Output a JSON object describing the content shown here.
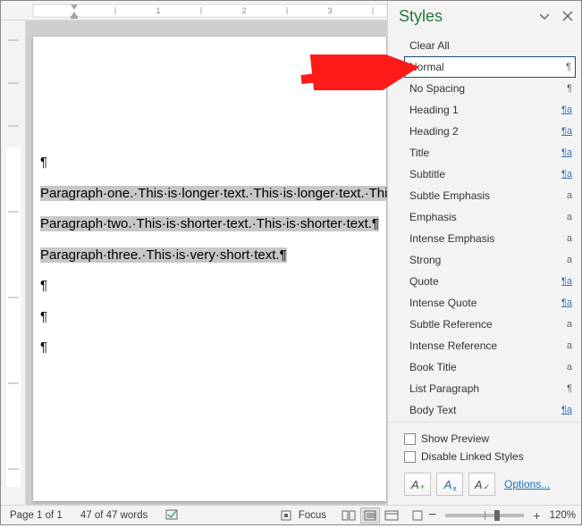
{
  "ruler": {
    "h_marks": [
      "1",
      "2",
      "3"
    ]
  },
  "document": {
    "blank_para_marker": "¶",
    "paragraphs": [
      "Paragraph·one.·This·is·longer·text.·This·is·longer·text.·This·is·longer·text.¶",
      "Paragraph·two.·This·is·shorter·text.·This·is·shorter·text.¶",
      "Paragraph·three.·This·is·very·short·text.¶"
    ]
  },
  "styles_pane": {
    "title": "Styles",
    "items": [
      {
        "label": "Clear All",
        "glyph": "",
        "glyph_style": "",
        "selected": false
      },
      {
        "label": "Normal",
        "glyph": "¶",
        "glyph_style": "",
        "selected": true
      },
      {
        "label": "No Spacing",
        "glyph": "¶",
        "glyph_style": "",
        "selected": false
      },
      {
        "label": "Heading 1",
        "glyph": "¶a",
        "glyph_style": "underline",
        "selected": false
      },
      {
        "label": "Heading 2",
        "glyph": "¶a",
        "glyph_style": "underline",
        "selected": false
      },
      {
        "label": "Title",
        "glyph": "¶a",
        "glyph_style": "underline",
        "selected": false
      },
      {
        "label": "Subtitle",
        "glyph": "¶a",
        "glyph_style": "underline",
        "selected": false
      },
      {
        "label": "Subtle Emphasis",
        "glyph": "a",
        "glyph_style": "",
        "selected": false
      },
      {
        "label": "Emphasis",
        "glyph": "a",
        "glyph_style": "",
        "selected": false
      },
      {
        "label": "Intense Emphasis",
        "glyph": "a",
        "glyph_style": "",
        "selected": false
      },
      {
        "label": "Strong",
        "glyph": "a",
        "glyph_style": "",
        "selected": false
      },
      {
        "label": "Quote",
        "glyph": "¶a",
        "glyph_style": "underline",
        "selected": false
      },
      {
        "label": "Intense Quote",
        "glyph": "¶a",
        "glyph_style": "underline",
        "selected": false
      },
      {
        "label": "Subtle Reference",
        "glyph": "a",
        "glyph_style": "",
        "selected": false
      },
      {
        "label": "Intense Reference",
        "glyph": "a",
        "glyph_style": "",
        "selected": false
      },
      {
        "label": "Book Title",
        "glyph": "a",
        "glyph_style": "",
        "selected": false
      },
      {
        "label": "List Paragraph",
        "glyph": "¶",
        "glyph_style": "",
        "selected": false
      },
      {
        "label": "Body Text",
        "glyph": "¶a",
        "glyph_style": "underline",
        "selected": false
      }
    ],
    "show_preview": "Show Preview",
    "disable_linked": "Disable Linked Styles",
    "options": "Options..."
  },
  "status_bar": {
    "page": "Page 1 of 1",
    "words": "47 of 47 words",
    "focus": "Focus",
    "zoom": "120%"
  }
}
